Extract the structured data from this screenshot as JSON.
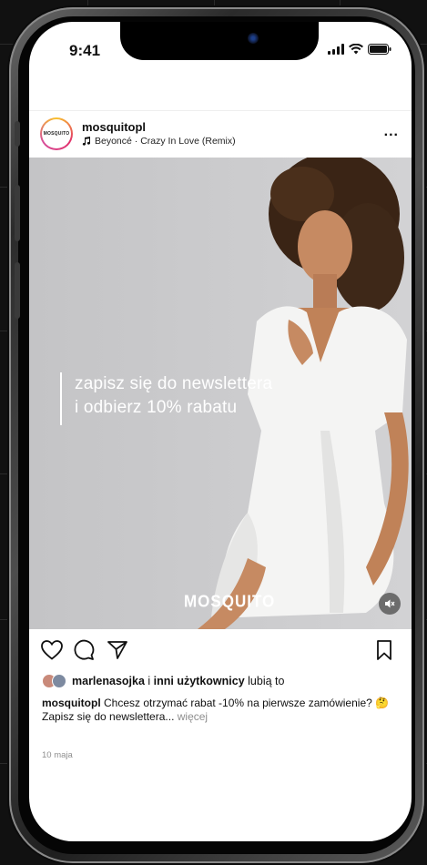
{
  "status": {
    "time": "9:41"
  },
  "post": {
    "avatar_text": "MOSQUITO",
    "username": "mosquitopl",
    "music": "Beyoncé · Crazy In Love (Remix)",
    "more": "...",
    "overlay_line1": "zapisz się do newslettera",
    "overlay_line2": "i odbierz 10% rabatu",
    "watermark": "MOSQUITO",
    "likes": {
      "user": "marlenasojka",
      "connector": " i ",
      "others": "inni użytkownicy",
      "suffix": " lubią to"
    },
    "caption": {
      "username": "mosquitopl",
      "text": " Chcesz otrzymać rabat -10% na pierwsze zamówienie? 🤔",
      "line2": "Zapisz się do newslettera...",
      "more": " więcej"
    },
    "date": "10 maja"
  },
  "icons": [
    "heart-icon",
    "comment-icon",
    "share-icon",
    "bookmark-icon",
    "music-note-icon",
    "mute-icon"
  ]
}
